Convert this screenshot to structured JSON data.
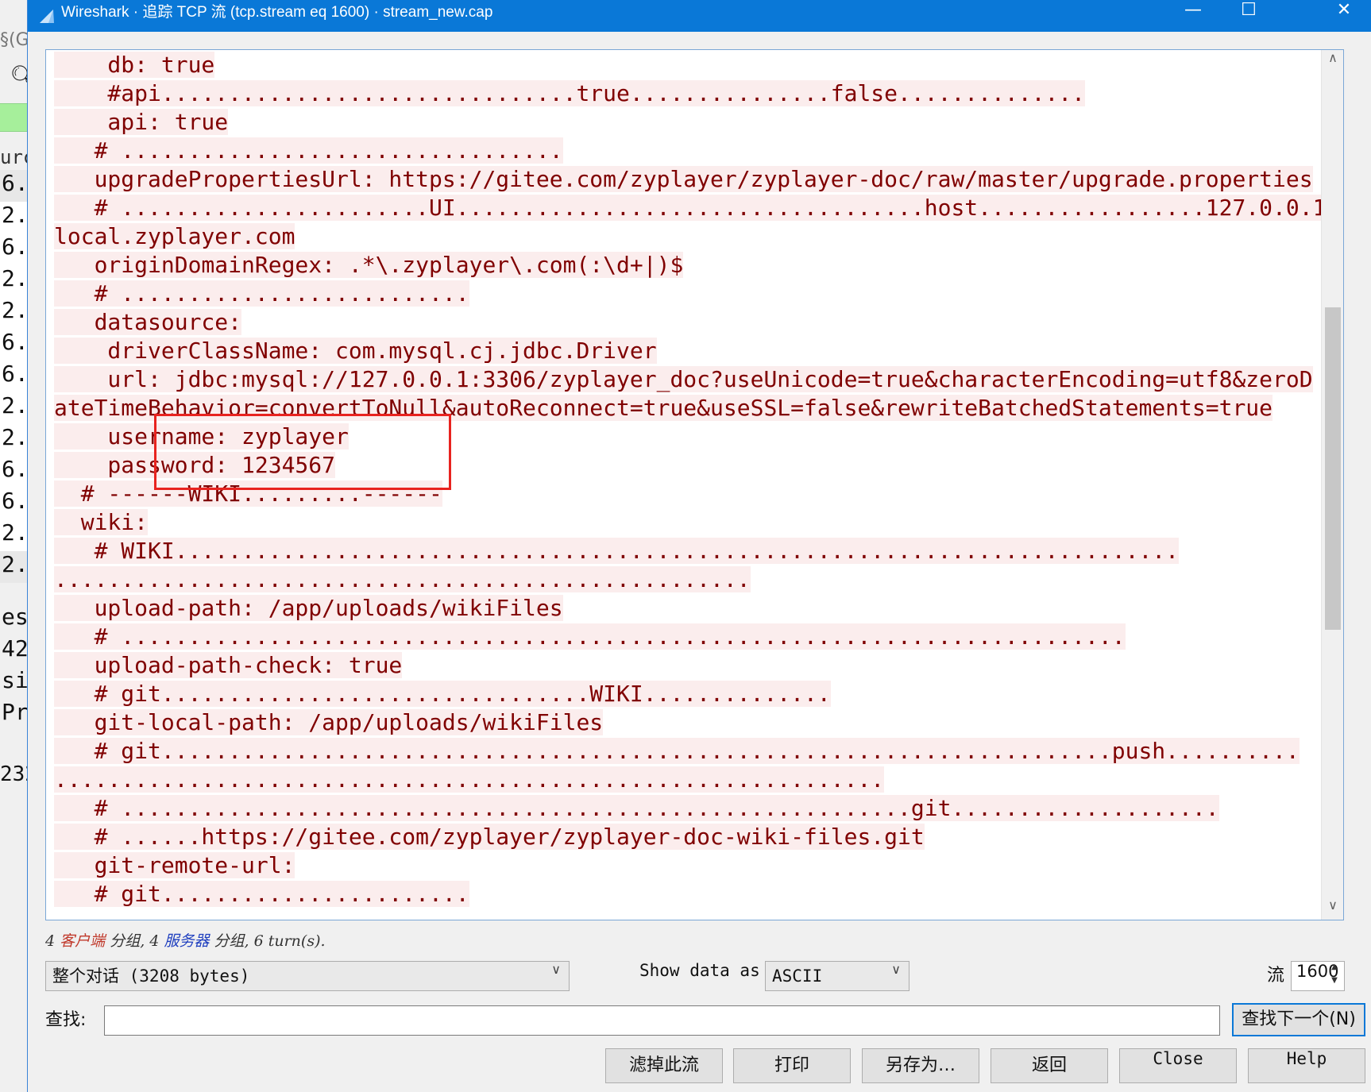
{
  "background": {
    "top_fragment": "§(G",
    "column_fragment": "urc",
    "rows": [
      "6.",
      "2.",
      "6.",
      "2.",
      "2.",
      "6.",
      "6.",
      "2.",
      "2.",
      "6.",
      "6.",
      "2.",
      "2."
    ],
    "detail_rows": [
      "es",
      "42",
      "si",
      "Pr"
    ],
    "hex_fragment": "232"
  },
  "window": {
    "title": "Wireshark · 追踪 TCP 流 (tcp.stream eq 1600) · stream_new.cap",
    "minimize": "—",
    "maximize": "☐",
    "close": "✕"
  },
  "stream": {
    "lines": [
      "    db: true",
      "    #api...............................true...............false..............",
      "    api: true",
      "   # .................................",
      "   upgradePropertiesUrl: https://gitee.com/zyplayer/zyplayer-doc/raw/master/upgrade.properties",
      "   # .......................UI...................................host.................127.0.0.1",
      "local.zyplayer.com",
      "   originDomainRegex: .*\\.zyplayer\\.com(:\\d+|)$",
      "   # ..........................",
      "   datasource:",
      "    driverClassName: com.mysql.cj.jdbc.Driver",
      "    url: jdbc:mysql://127.0.0.1:3306/zyplayer_doc?useUnicode=true&characterEncoding=utf8&zeroD",
      "ateTimeBehavior=convertToNull&autoReconnect=true&useSSL=false&rewriteBatchedStatements=true",
      "    username: zyplayer",
      "    password: 1234567",
      "  # ------WIKI.........------",
      "  wiki:",
      "   # WIKI...........................................................................",
      "....................................................",
      "   upload-path: /app/uploads/wikiFiles",
      "   # ...........................................................................",
      "   upload-path-check: true",
      "   # git................................WIKI..............",
      "   git-local-path: /app/uploads/wikiFiles",
      "   # git.......................................................................push..........",
      "..............................................................",
      "   # ...........................................................git....................",
      "   # ......https://gitee.com/zyplayer/zyplayer-doc-wiki-files.git",
      "   git-remote-url:",
      "   # git......................."
    ]
  },
  "summary": {
    "count1": "4",
    "client": "客户端",
    "packets1": "分组,",
    "count2": "4",
    "server": "服务器",
    "packets2": "分组,",
    "turns": "6 turn(s)."
  },
  "controls": {
    "conversation_select": "整个对话 (3208 bytes)",
    "show_data_label": "Show data as",
    "format_select": "ASCII",
    "stream_label": "流",
    "stream_value": "1600",
    "find_label": "查找:",
    "find_value": "",
    "find_next": "查找下一个(N)"
  },
  "buttons": {
    "filter_out": "滤掉此流",
    "print": "打印",
    "save_as": "另存为…",
    "back": "返回",
    "close": "Close",
    "help": "Help"
  },
  "colors": {
    "titlebar": "#0a78d7",
    "client_text": "#800000",
    "client_bg": "#fbeded",
    "highlight": "#e8231f"
  }
}
